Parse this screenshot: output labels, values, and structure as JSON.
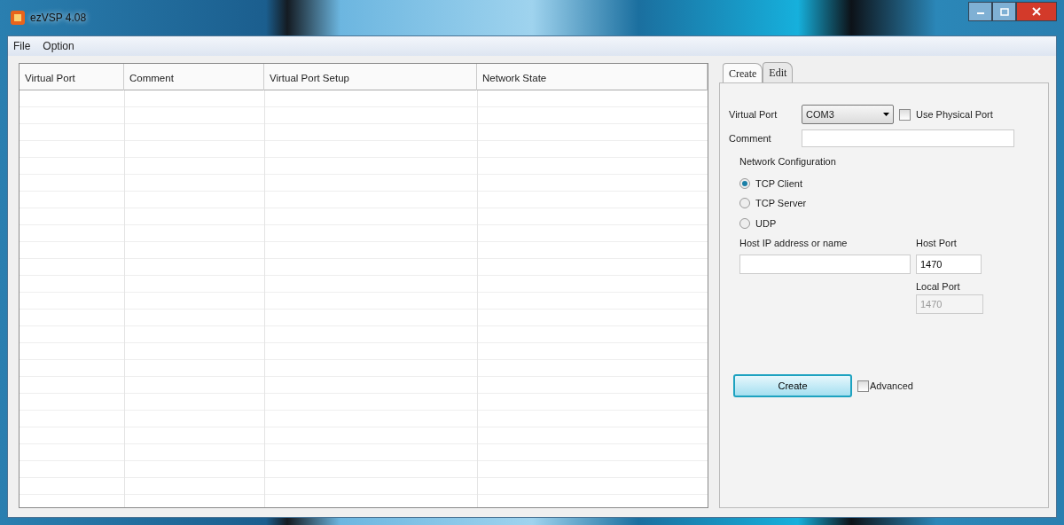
{
  "window": {
    "title": "ezVSP 4.08"
  },
  "menu": [
    {
      "label": "File"
    },
    {
      "label": "Option"
    }
  ],
  "table": {
    "columns": [
      "Virtual Port",
      "Comment",
      "Virtual Port Setup",
      "Network State"
    ]
  },
  "tabs": [
    {
      "label": "Create",
      "selected": true
    },
    {
      "label": "Edit",
      "selected": false
    }
  ],
  "form": {
    "virtual_port": {
      "label": "Virtual Port",
      "value": "COM3"
    },
    "use_physical_port": {
      "label": "Use Physical Port",
      "checked": false
    },
    "comment": {
      "label": "Comment"
    },
    "network_configuration": {
      "title": "Network Configuration",
      "options": [
        {
          "label": "TCP Client",
          "selected": true
        },
        {
          "label": "TCP Server",
          "selected": false
        },
        {
          "label": "UDP",
          "selected": false
        }
      ]
    },
    "host_ip": {
      "label": "Host IP address or name"
    },
    "host_port": {
      "label": "Host Port",
      "value": "1470"
    },
    "local_port": {
      "label": "Local Port",
      "value": "1470",
      "disabled": true
    }
  },
  "create_button": {
    "label": "Create"
  },
  "advanced": {
    "label": "Advanced",
    "checked": false
  }
}
